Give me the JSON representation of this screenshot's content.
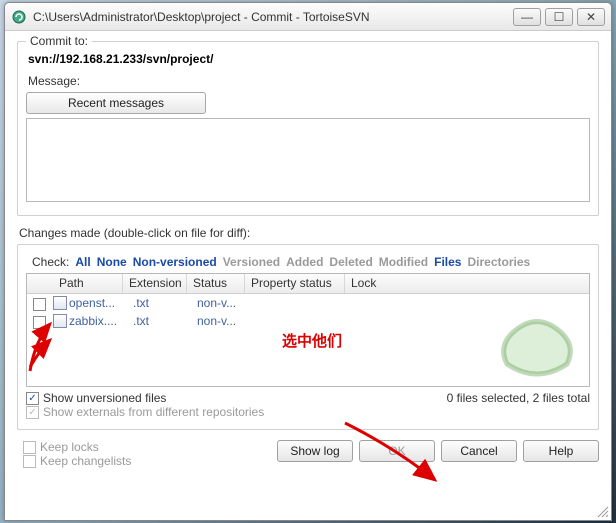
{
  "window": {
    "title": "C:\\Users\\Administrator\\Desktop\\project - Commit - TortoiseSVN"
  },
  "commit": {
    "group_label": "Commit to:",
    "url": "svn://192.168.21.233/svn/project/",
    "message_label": "Message:",
    "recent_button": "Recent messages",
    "message_value": ""
  },
  "changes": {
    "label": "Changes made (double-click on file for diff):",
    "check_label": "Check:",
    "filters": {
      "all": "All",
      "none": "None",
      "nonversioned": "Non-versioned",
      "versioned": "Versioned",
      "added": "Added",
      "deleted": "Deleted",
      "modified": "Modified",
      "files": "Files",
      "directories": "Directories"
    },
    "columns": {
      "path": "Path",
      "extension": "Extension",
      "status": "Status",
      "property": "Property status",
      "lock": "Lock"
    },
    "rows": [
      {
        "name": "openst...",
        "ext": ".txt",
        "status": "non-v..."
      },
      {
        "name": "zabbix....",
        "ext": ".txt",
        "status": "non-v..."
      }
    ],
    "show_unversioned": "Show unversioned files",
    "show_externals": "Show externals from different repositories",
    "status": "0 files selected, 2 files total"
  },
  "keep": {
    "locks": "Keep locks",
    "changelists": "Keep changelists"
  },
  "buttons": {
    "showlog": "Show log",
    "ok": "OK",
    "cancel": "Cancel",
    "help": "Help"
  },
  "annotation": {
    "text": "选中他们"
  }
}
